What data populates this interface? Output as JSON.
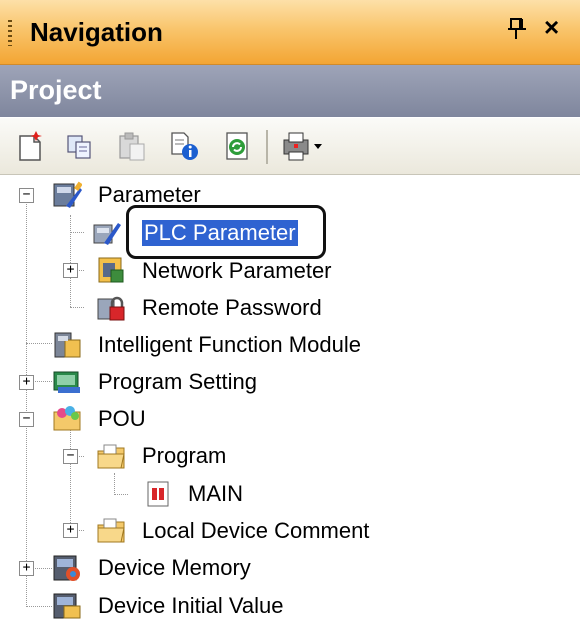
{
  "titlebar": {
    "title": "Navigation",
    "pin_symbol": "¶",
    "close_symbol": "×"
  },
  "project": {
    "label": "Project"
  },
  "toolbar": {
    "buttons": [
      "new-data-icon",
      "copy-icon",
      "paste-icon",
      "properties-icon",
      "refresh-icon",
      "print-dropdown-icon"
    ]
  },
  "tree": {
    "items": [
      {
        "label": "Parameter",
        "icon": "parameter-icon",
        "expanded": true
      },
      {
        "label": "PLC Parameter",
        "icon": "plc-parameter-icon",
        "selected": true
      },
      {
        "label": "Network Parameter",
        "icon": "network-parameter-icon",
        "expanded": false
      },
      {
        "label": "Remote Password",
        "icon": "remote-password-icon"
      },
      {
        "label": "Intelligent Function Module",
        "icon": "intelligent-function-module-icon"
      },
      {
        "label": "Program Setting",
        "icon": "program-setting-icon",
        "expanded": false
      },
      {
        "label": "POU",
        "icon": "pou-icon",
        "expanded": true
      },
      {
        "label": "Program",
        "icon": "program-folder-icon",
        "expanded": true
      },
      {
        "label": "MAIN",
        "icon": "main-program-icon"
      },
      {
        "label": "Local Device Comment",
        "icon": "local-device-comment-icon",
        "expanded": false
      },
      {
        "label": "Device Memory",
        "icon": "device-memory-icon",
        "expanded": false
      },
      {
        "label": "Device Initial Value",
        "icon": "device-initial-value-icon"
      }
    ]
  },
  "colors": {
    "title_orange": "#f9c56c",
    "project_gray": "#8f95aa",
    "selection_blue": "#2f63d1"
  }
}
